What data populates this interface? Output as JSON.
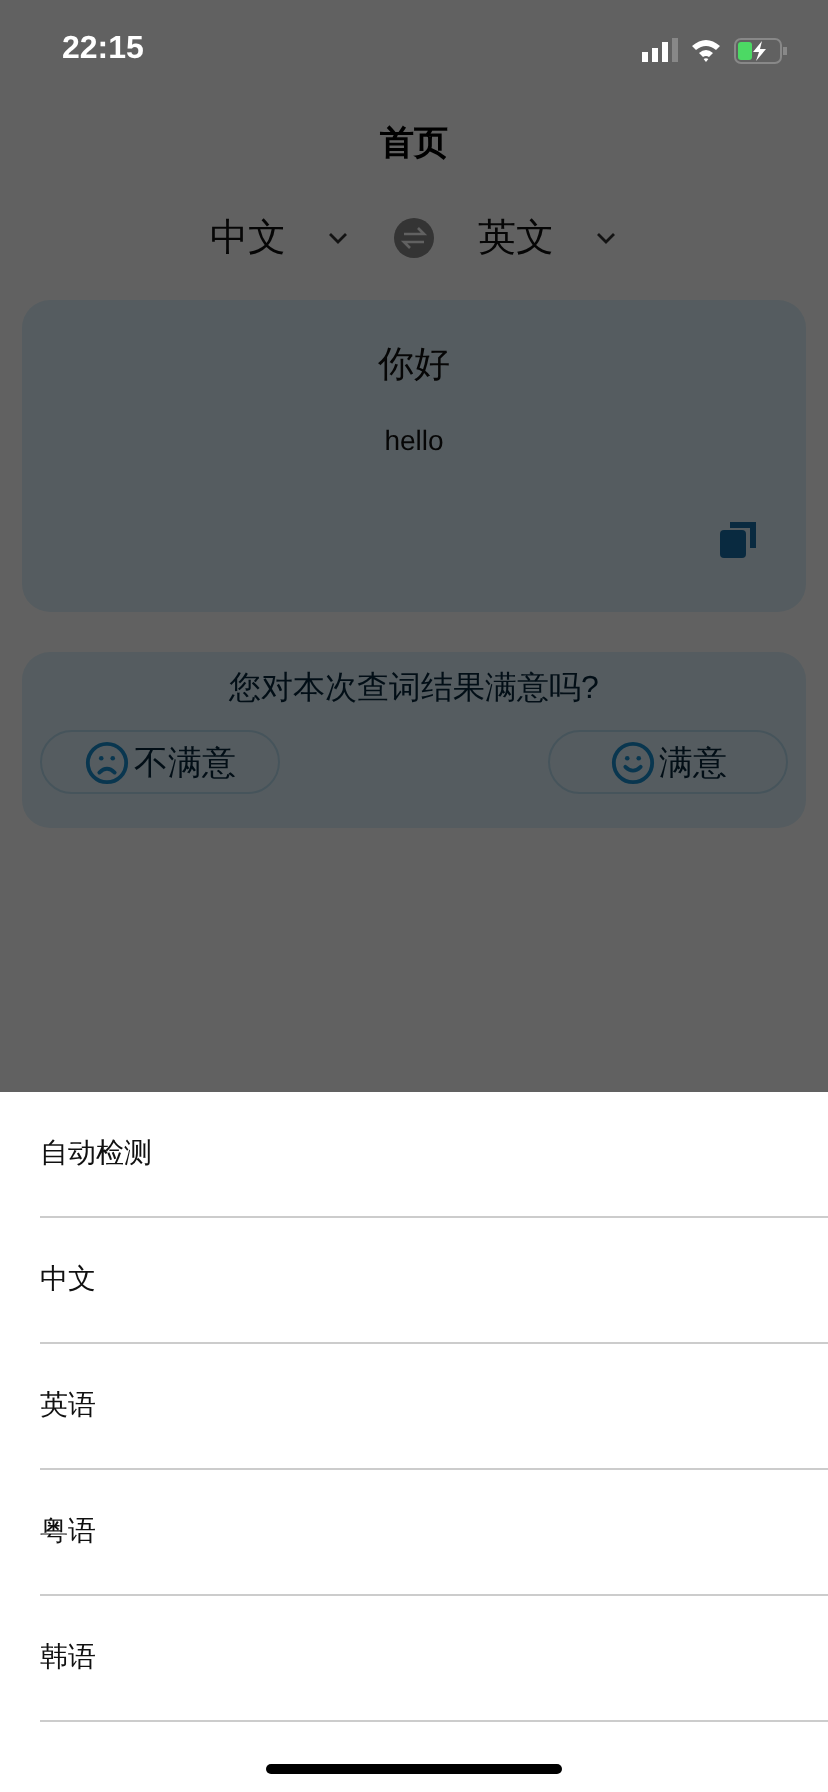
{
  "status_bar": {
    "time": "22:15"
  },
  "title": "首页",
  "languages": {
    "source": "中文",
    "target": "英文"
  },
  "result": {
    "source_text": "你好",
    "translation": "hello"
  },
  "feedback": {
    "question": "您对本次查词结果满意吗?",
    "buttons": [
      {
        "kind": "unhappy",
        "label": "不满意"
      },
      {
        "kind": "happy",
        "label": "满意"
      }
    ]
  },
  "sheet": {
    "options": [
      "自动检测",
      "中文",
      "英语",
      "粤语",
      "韩语"
    ]
  }
}
